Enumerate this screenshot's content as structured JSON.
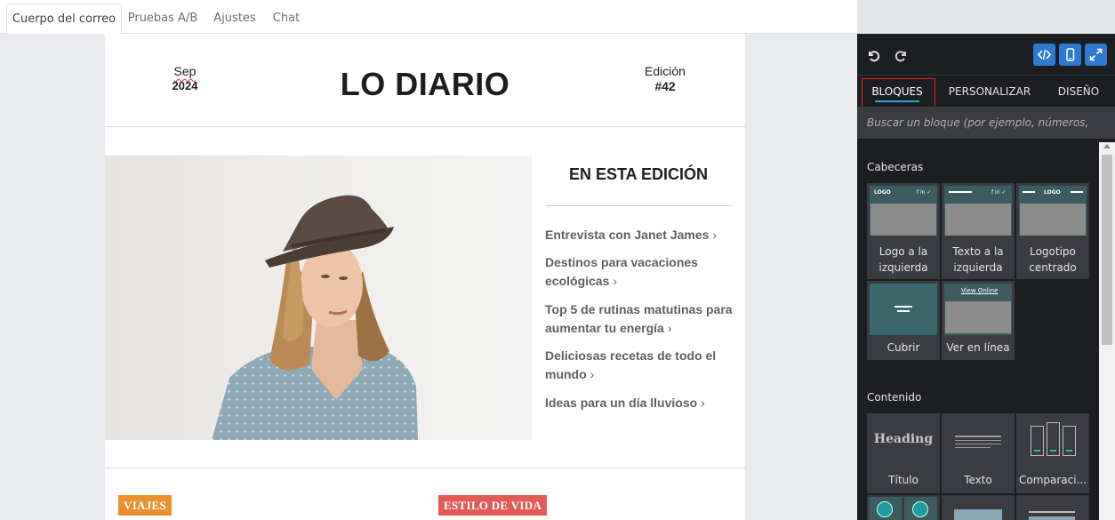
{
  "tabs": [
    {
      "label": "Cuerpo del correo",
      "active": true
    },
    {
      "label": "Pruebas A/B",
      "active": false
    },
    {
      "label": "Ajustes",
      "active": false
    },
    {
      "label": "Chat",
      "active": false
    }
  ],
  "newsletter": {
    "month": "Sep",
    "year": "2024",
    "title": "LO DIARIO",
    "edition_label": "Edición",
    "edition_number": "#42",
    "toc_title": "EN ESTA EDICIÓN",
    "toc_items": [
      "Entrevista con Janet James",
      "Destinos para vacaciones ecológicas",
      "Top 5 de rutinas matutinas para aumentar tu energía",
      "Deliciosas recetas de todo el mundo",
      "Ideas para un día lluvioso"
    ],
    "badges": [
      {
        "label": "VIAJES",
        "color": "#e8912e"
      },
      {
        "label": "ESTILO DE VIDA",
        "color": "#e25b58"
      }
    ]
  },
  "panel": {
    "toolbar": {
      "undo_icon": "undo-icon",
      "redo_icon": "redo-icon",
      "code_icon": "code-view-icon",
      "mobile_icon": "mobile-preview-icon",
      "fullscreen_icon": "fullscreen-icon",
      "accent_color": "#2f7ad1"
    },
    "tabs": [
      {
        "label": "BLOQUES",
        "active": true
      },
      {
        "label": "PERSONALIZAR",
        "active": false
      },
      {
        "label": "DISEÑO",
        "active": false
      }
    ],
    "search_placeholder": "Buscar un bloque (por ejemplo, números, muro de",
    "sections": [
      {
        "title": "Cabeceras",
        "blocks": [
          {
            "label_line1": "Logo a la",
            "label_line2": "izquierda",
            "thumb_text": "LOGO"
          },
          {
            "label_line1": "Texto a la",
            "label_line2": "izquierda",
            "thumb_text": ""
          },
          {
            "label_line1": "Logotipo",
            "label_line2": "centrado",
            "thumb_text": "LOGO"
          },
          {
            "label_line1": "Cubrir",
            "label_line2": "",
            "thumb_text": ""
          },
          {
            "label_line1": "Ver en línea",
            "label_line2": "",
            "thumb_text": "View Online"
          }
        ]
      },
      {
        "title": "Contenido",
        "blocks": [
          {
            "label_line1": "Título",
            "thumb_text": "Heading"
          },
          {
            "label_line1": "Texto",
            "thumb_text": ""
          },
          {
            "label_line1": "Comparaci...",
            "thumb_text": ""
          }
        ]
      }
    ]
  }
}
